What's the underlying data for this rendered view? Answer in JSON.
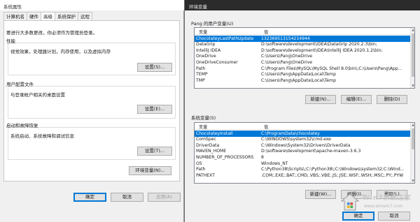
{
  "left_window": {
    "title": "系统属性",
    "tabs": [
      "计算机名",
      "硬件",
      "高级",
      "系统保护",
      "远程"
    ],
    "active_tab": 2,
    "admin_note": "要进行大多数更改，你必须作为管理员登录。",
    "groups": [
      {
        "title": "性能",
        "desc": "视觉效果，处理器计划，内存使用，以及虚拟内存",
        "button": "设置(S)..."
      },
      {
        "title": "用户配置文件",
        "desc": "与登录帐户相关的桌面设置",
        "button": "设置(E)..."
      },
      {
        "title": "启动和故障恢复",
        "desc": "系统启动、系统故障和调试信息",
        "button": "设置(T)..."
      }
    ],
    "env_button": "环境变量(N)...",
    "footer": {
      "ok": "确定",
      "cancel": "取消",
      "apply": "应用(A)"
    }
  },
  "right_window": {
    "title": "环境变量",
    "user_section_label": "Pang 的用户变量(U)",
    "system_section_label": "系统变量(S)",
    "col_var": "变量",
    "col_val": "值",
    "user_vars": [
      {
        "name": "ChocolateyLastPathUpdate",
        "value": "132369513154214944",
        "selected": true
      },
      {
        "name": "DataGrip",
        "value": "D:\\software\\development\\IDEA\\DataGrip 2020.2.3\\bin;"
      },
      {
        "name": "IntelliJ IDEA",
        "value": "D:\\software\\development\\IDEA\\IntelliJ IDEA 2020.1.2\\bin;"
      },
      {
        "name": "OneDrive",
        "value": "C:\\Users\\Pang\\OneDrive"
      },
      {
        "name": "OneDriveConsumer",
        "value": "C:\\Users\\Pang\\OneDrive"
      },
      {
        "name": "Path",
        "value": "C:\\Program Files\\MySQL\\MySQL Shell 8.0\\bin\\;C:\\Users\\Pang\\App..."
      },
      {
        "name": "TEMP",
        "value": "C:\\Users\\Pang\\AppData\\Local\\Temp"
      },
      {
        "name": "TMP",
        "value": "C:\\Users\\Pang\\AppData\\Local\\Temp"
      }
    ],
    "user_buttons": {
      "new": "新建(N)...",
      "edit": "编辑(E)...",
      "delete": "删除(D)"
    },
    "system_vars": [
      {
        "name": "ChocolateyInstall",
        "value": "C:\\ProgramData\\chocolatey",
        "selected": true
      },
      {
        "name": "ComSpec",
        "value": "C:\\WINDOWS\\system32\\cmd.exe"
      },
      {
        "name": "DriverData",
        "value": "C:\\Windows\\System32\\Drivers\\DriverData"
      },
      {
        "name": "MAVEN_HOME",
        "value": "D:\\software\\development\\apache-maven-3.6.3"
      },
      {
        "name": "NUMBER_OF_PROCESSORS",
        "value": "8"
      },
      {
        "name": "OS",
        "value": "Windows_NT"
      },
      {
        "name": "Path",
        "value": "C:\\Python38\\Scripts\\;C:\\Python38\\;C:\\Windows\\system32;C:\\Wind..."
      },
      {
        "name": "PATHEXT",
        "value": ".COM;.EXE;.BAT;.CMD;.VBS;.VBE;.JS;.JSE;.WSF;.WSH;.MSC;.PY;.PYW"
      }
    ],
    "system_buttons": {
      "new": "新建(W)...",
      "edit": "编辑(I)...",
      "delete": "删除(L)"
    },
    "footer": {
      "ok": "确定",
      "cancel": "取消"
    }
  },
  "watermark": {
    "text": "Win7系统之家",
    "sub": "www.winwin7.com"
  },
  "colors": {
    "selection": "#0078d7",
    "dialog_bg": "#f0f0f0",
    "desktop": "#1f2a36"
  }
}
